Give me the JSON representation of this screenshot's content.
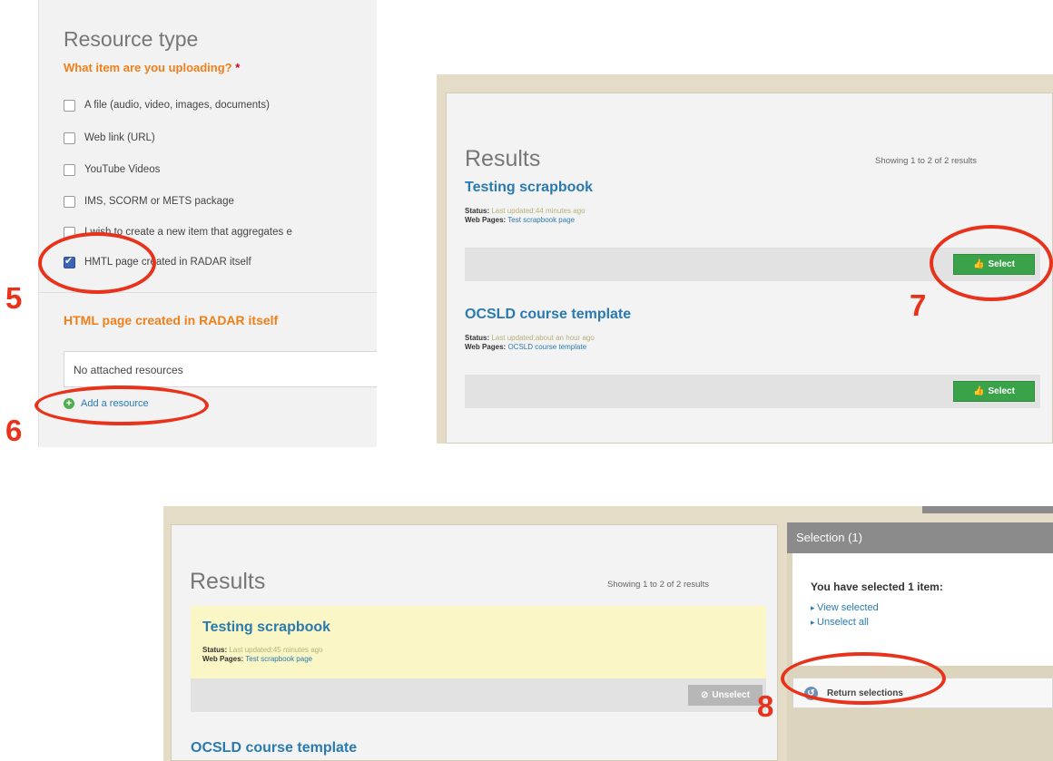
{
  "panel1": {
    "heading": "Resource type",
    "question": "What item are you uploading?",
    "required_mark": "*",
    "options": [
      {
        "label": "A file (audio, video, images, documents)",
        "checked": false
      },
      {
        "label": "Web link (URL)",
        "checked": false
      },
      {
        "label": "YouTube Videos",
        "checked": false
      },
      {
        "label": "IMS, SCORM or METS package",
        "checked": false
      },
      {
        "label": "I wish to create a new item that aggregates e",
        "checked": false
      },
      {
        "label": "HMTL page created in RADAR itself",
        "checked": true
      }
    ],
    "section_title": "HTML page created in RADAR itself",
    "attached_text": "No attached resources",
    "add_resource": "Add a resource"
  },
  "panel2": {
    "heading": "Results",
    "showing": "Showing 1 to 2 of 2 results",
    "items": [
      {
        "title": "Testing scrapbook",
        "status_label": "Status:",
        "status_value": "Last updated:44 minutes ago",
        "pages_label": "Web Pages:",
        "pages_value": "Test scrapbook page",
        "button": "Select"
      },
      {
        "title": "OCSLD course template",
        "status_label": "Status:",
        "status_value": "Last updated:about an hour ago",
        "pages_label": "Web Pages:",
        "pages_value": "OCSLD course template",
        "button": "Select"
      }
    ]
  },
  "panel3": {
    "heading": "Results",
    "showing": "Showing 1 to 2 of 2 results",
    "items": [
      {
        "title": "Testing scrapbook",
        "status_label": "Status:",
        "status_value": "Last updated:45 minutes ago",
        "pages_label": "Web Pages:",
        "pages_value": "Test scrapbook page",
        "button": "Unselect"
      },
      {
        "title": "OCSLD course template"
      }
    ],
    "selection": {
      "header": "Selection (1)",
      "text": "You have selected 1 item:",
      "view_selected": "View selected",
      "unselect_all": "Unselect all",
      "return_button": "Return selections"
    }
  },
  "annotations": {
    "step5": "5",
    "step6": "6",
    "step7": "7",
    "step8": "8"
  },
  "colors": {
    "annotation": "#e8321b",
    "accent_orange": "#f07f1a",
    "link_blue": "#2a7ab0",
    "select_green": "#3aa34a",
    "highlight_yellow": "#fbf6c5"
  }
}
